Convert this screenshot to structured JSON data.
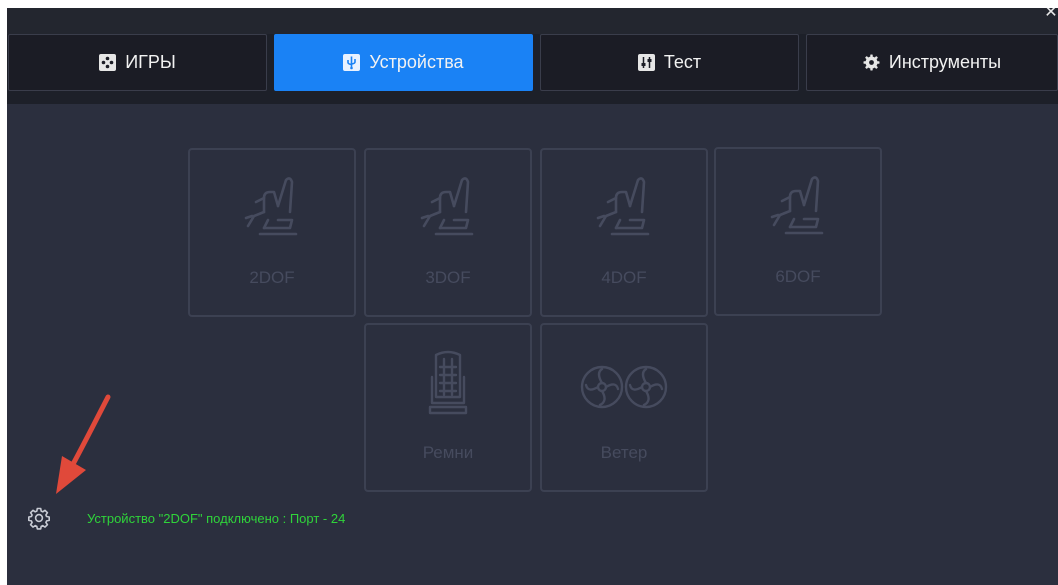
{
  "window": {
    "close_glyph": "✕"
  },
  "tabs": [
    {
      "label": "ИГРЫ",
      "icon": "gamepad-icon",
      "active": false
    },
    {
      "label": "Устройства",
      "icon": "usb-icon",
      "active": true
    },
    {
      "label": "Тест",
      "icon": "sliders-icon",
      "active": false
    },
    {
      "label": "Инструменты",
      "icon": "gear-icon",
      "active": false
    }
  ],
  "devices": [
    {
      "label": "2DOF",
      "icon": "motion-seat-icon"
    },
    {
      "label": "3DOF",
      "icon": "motion-seat-icon"
    },
    {
      "label": "4DOF",
      "icon": "motion-seat-icon"
    },
    {
      "label": "6DOF",
      "icon": "motion-seat-icon"
    },
    {
      "label": "Ремни",
      "icon": "seatbelt-icon"
    },
    {
      "label": "Ветер",
      "icon": "fans-icon"
    }
  ],
  "status": {
    "text": "Устройство \"2DOF\" подключено : Порт - 24",
    "icon": "settings-gear-icon"
  },
  "colors": {
    "accent": "#1a82f5",
    "status_text": "#2fd43a",
    "annotation_arrow": "#e0493a"
  }
}
